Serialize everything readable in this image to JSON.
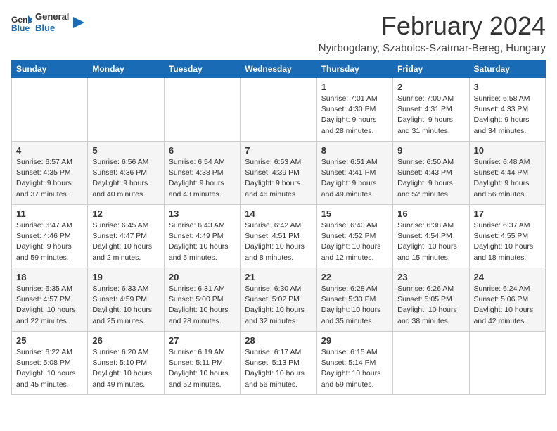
{
  "logo": {
    "text_general": "General",
    "text_blue": "Blue"
  },
  "calendar": {
    "title": "February 2024",
    "subtitle": "Nyirbogdany, Szabolcs-Szatmar-Bereg, Hungary",
    "days_of_week": [
      "Sunday",
      "Monday",
      "Tuesday",
      "Wednesday",
      "Thursday",
      "Friday",
      "Saturday"
    ],
    "weeks": [
      {
        "shaded": false,
        "days": [
          {
            "num": "",
            "info": ""
          },
          {
            "num": "",
            "info": ""
          },
          {
            "num": "",
            "info": ""
          },
          {
            "num": "",
            "info": ""
          },
          {
            "num": "1",
            "info": "Sunrise: 7:01 AM\nSunset: 4:30 PM\nDaylight: 9 hours\nand 28 minutes."
          },
          {
            "num": "2",
            "info": "Sunrise: 7:00 AM\nSunset: 4:31 PM\nDaylight: 9 hours\nand 31 minutes."
          },
          {
            "num": "3",
            "info": "Sunrise: 6:58 AM\nSunset: 4:33 PM\nDaylight: 9 hours\nand 34 minutes."
          }
        ]
      },
      {
        "shaded": true,
        "days": [
          {
            "num": "4",
            "info": "Sunrise: 6:57 AM\nSunset: 4:35 PM\nDaylight: 9 hours\nand 37 minutes."
          },
          {
            "num": "5",
            "info": "Sunrise: 6:56 AM\nSunset: 4:36 PM\nDaylight: 9 hours\nand 40 minutes."
          },
          {
            "num": "6",
            "info": "Sunrise: 6:54 AM\nSunset: 4:38 PM\nDaylight: 9 hours\nand 43 minutes."
          },
          {
            "num": "7",
            "info": "Sunrise: 6:53 AM\nSunset: 4:39 PM\nDaylight: 9 hours\nand 46 minutes."
          },
          {
            "num": "8",
            "info": "Sunrise: 6:51 AM\nSunset: 4:41 PM\nDaylight: 9 hours\nand 49 minutes."
          },
          {
            "num": "9",
            "info": "Sunrise: 6:50 AM\nSunset: 4:43 PM\nDaylight: 9 hours\nand 52 minutes."
          },
          {
            "num": "10",
            "info": "Sunrise: 6:48 AM\nSunset: 4:44 PM\nDaylight: 9 hours\nand 56 minutes."
          }
        ]
      },
      {
        "shaded": false,
        "days": [
          {
            "num": "11",
            "info": "Sunrise: 6:47 AM\nSunset: 4:46 PM\nDaylight: 9 hours\nand 59 minutes."
          },
          {
            "num": "12",
            "info": "Sunrise: 6:45 AM\nSunset: 4:47 PM\nDaylight: 10 hours\nand 2 minutes."
          },
          {
            "num": "13",
            "info": "Sunrise: 6:43 AM\nSunset: 4:49 PM\nDaylight: 10 hours\nand 5 minutes."
          },
          {
            "num": "14",
            "info": "Sunrise: 6:42 AM\nSunset: 4:51 PM\nDaylight: 10 hours\nand 8 minutes."
          },
          {
            "num": "15",
            "info": "Sunrise: 6:40 AM\nSunset: 4:52 PM\nDaylight: 10 hours\nand 12 minutes."
          },
          {
            "num": "16",
            "info": "Sunrise: 6:38 AM\nSunset: 4:54 PM\nDaylight: 10 hours\nand 15 minutes."
          },
          {
            "num": "17",
            "info": "Sunrise: 6:37 AM\nSunset: 4:55 PM\nDaylight: 10 hours\nand 18 minutes."
          }
        ]
      },
      {
        "shaded": true,
        "days": [
          {
            "num": "18",
            "info": "Sunrise: 6:35 AM\nSunset: 4:57 PM\nDaylight: 10 hours\nand 22 minutes."
          },
          {
            "num": "19",
            "info": "Sunrise: 6:33 AM\nSunset: 4:59 PM\nDaylight: 10 hours\nand 25 minutes."
          },
          {
            "num": "20",
            "info": "Sunrise: 6:31 AM\nSunset: 5:00 PM\nDaylight: 10 hours\nand 28 minutes."
          },
          {
            "num": "21",
            "info": "Sunrise: 6:30 AM\nSunset: 5:02 PM\nDaylight: 10 hours\nand 32 minutes."
          },
          {
            "num": "22",
            "info": "Sunrise: 6:28 AM\nSunset: 5:33 PM\nDaylight: 10 hours\nand 35 minutes."
          },
          {
            "num": "23",
            "info": "Sunrise: 6:26 AM\nSunset: 5:05 PM\nDaylight: 10 hours\nand 38 minutes."
          },
          {
            "num": "24",
            "info": "Sunrise: 6:24 AM\nSunset: 5:06 PM\nDaylight: 10 hours\nand 42 minutes."
          }
        ]
      },
      {
        "shaded": false,
        "days": [
          {
            "num": "25",
            "info": "Sunrise: 6:22 AM\nSunset: 5:08 PM\nDaylight: 10 hours\nand 45 minutes."
          },
          {
            "num": "26",
            "info": "Sunrise: 6:20 AM\nSunset: 5:10 PM\nDaylight: 10 hours\nand 49 minutes."
          },
          {
            "num": "27",
            "info": "Sunrise: 6:19 AM\nSunset: 5:11 PM\nDaylight: 10 hours\nand 52 minutes."
          },
          {
            "num": "28",
            "info": "Sunrise: 6:17 AM\nSunset: 5:13 PM\nDaylight: 10 hours\nand 56 minutes."
          },
          {
            "num": "29",
            "info": "Sunrise: 6:15 AM\nSunset: 5:14 PM\nDaylight: 10 hours\nand 59 minutes."
          },
          {
            "num": "",
            "info": ""
          },
          {
            "num": "",
            "info": ""
          }
        ]
      }
    ]
  }
}
